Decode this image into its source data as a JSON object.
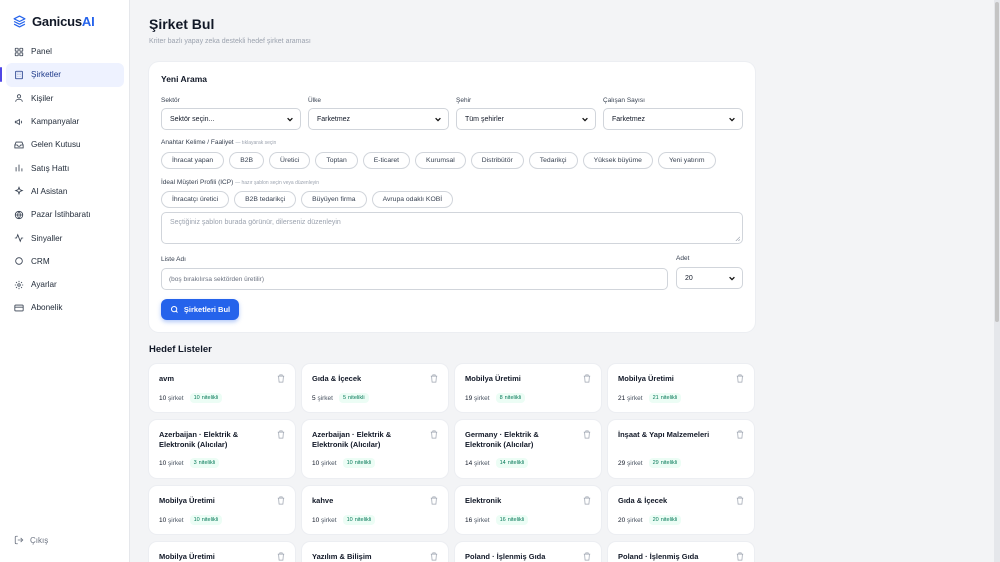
{
  "brand": {
    "name_main": "Ganicus",
    "name_accent": "AI"
  },
  "nav": [
    {
      "label": "Panel",
      "icon": "grid-icon"
    },
    {
      "label": "Şirketler",
      "icon": "building-icon",
      "active": true
    },
    {
      "label": "Kişiler",
      "icon": "user-icon"
    },
    {
      "label": "Kampanyalar",
      "icon": "megaphone-icon"
    },
    {
      "label": "Gelen Kutusu",
      "icon": "inbox-icon"
    },
    {
      "label": "Satış Hattı",
      "icon": "pipeline-icon"
    },
    {
      "label": "AI Asistan",
      "icon": "bot-icon"
    },
    {
      "label": "Pazar İstihbaratı",
      "icon": "globe-icon"
    },
    {
      "label": "Sinyaller",
      "icon": "activity-icon"
    },
    {
      "label": "CRM",
      "icon": "circle-icon"
    },
    {
      "label": "Ayarlar",
      "icon": "gear-icon"
    },
    {
      "label": "Abonelik",
      "icon": "card-icon"
    }
  ],
  "logout": "Çıkış",
  "page": {
    "title": "Şirket Bul",
    "subtitle": "Kriter bazlı yapay zeka destekli hedef şirket araması"
  },
  "search": {
    "title": "Yeni Arama",
    "sector_label": "Sektör",
    "sector_value": "Sektör seçin...",
    "country_label": "Ülke",
    "country_value": "Farketmez",
    "city_label": "Şehir",
    "city_value": "Tüm şehirler",
    "employees_label": "Çalışan Sayısı",
    "employees_value": "Farketmez",
    "keywords_label": "Anahtar Kelime / Faaliyet",
    "keywords_hint": "— tıklayarak seçin",
    "keywords": [
      "İhracat yapan",
      "B2B",
      "Üretici",
      "Toptan",
      "E-ticaret",
      "Kurumsal",
      "Distribütör",
      "Tedarikçi",
      "Yüksek büyüme",
      "Yeni yatırım"
    ],
    "icp_label": "İdeal Müşteri Profili (ICP)",
    "icp_hint": "— hazır şablon seçin veya düzenleyin",
    "icp_templates": [
      "İhracatçı üretici",
      "B2B tedarikçi",
      "Büyüyen firma",
      "Avrupa odaklı KOBİ"
    ],
    "icp_placeholder": "Seçtiğiniz şablon burada görünür, dilerseniz düzenleyin",
    "list_name_label": "Liste Adı",
    "list_name_placeholder": "(boş bırakılırsa sektörden üretilir)",
    "count_label": "Adet",
    "count_value": "20",
    "submit": "Şirketleri Bul"
  },
  "lists_title": "Hedef Listeler",
  "lists": [
    {
      "name": "avm",
      "count": "10",
      "qualified": "10"
    },
    {
      "name": "Gıda & İçecek",
      "count": "5",
      "qualified": "5"
    },
    {
      "name": "Mobilya Üretimi",
      "count": "19",
      "qualified": "8"
    },
    {
      "name": "Mobilya Üretimi",
      "count": "21",
      "qualified": "21"
    },
    {
      "name": "Azerbaijan · Elektrik & Elektronik (Alıcılar)",
      "count": "10",
      "qualified": "3"
    },
    {
      "name": "Azerbaijan · Elektrik & Elektronik (Alıcılar)",
      "count": "10",
      "qualified": "10"
    },
    {
      "name": "Germany · Elektrik & Elektronik (Alıcılar)",
      "count": "14",
      "qualified": "14"
    },
    {
      "name": "İnşaat & Yapı Malzemeleri",
      "count": "29",
      "qualified": "29"
    },
    {
      "name": "Mobilya Üretimi",
      "count": "10",
      "qualified": "10"
    },
    {
      "name": "kahve",
      "count": "10",
      "qualified": "10"
    },
    {
      "name": "Elektronik",
      "count": "16",
      "qualified": "16"
    },
    {
      "name": "Gıda & İçecek",
      "count": "20",
      "qualified": "20"
    },
    {
      "name": "Mobilya Üretimi",
      "count": "",
      "qualified": ""
    },
    {
      "name": "Yazılım & Bilişim",
      "count": "",
      "qualified": ""
    },
    {
      "name": "Poland · İşlenmiş Gıda (Alıcılar)",
      "count": "",
      "qualified": ""
    },
    {
      "name": "Poland · İşlenmiş Gıda (Alıcılar)",
      "count": "",
      "qualified": ""
    }
  ],
  "unit_company": "şirket",
  "unit_qualified": "nitelikli",
  "colors": {
    "accent": "#2563eb",
    "active_bg": "#eef2ff",
    "badge_text": "#047857",
    "badge_bg": "#ecfdf5"
  }
}
